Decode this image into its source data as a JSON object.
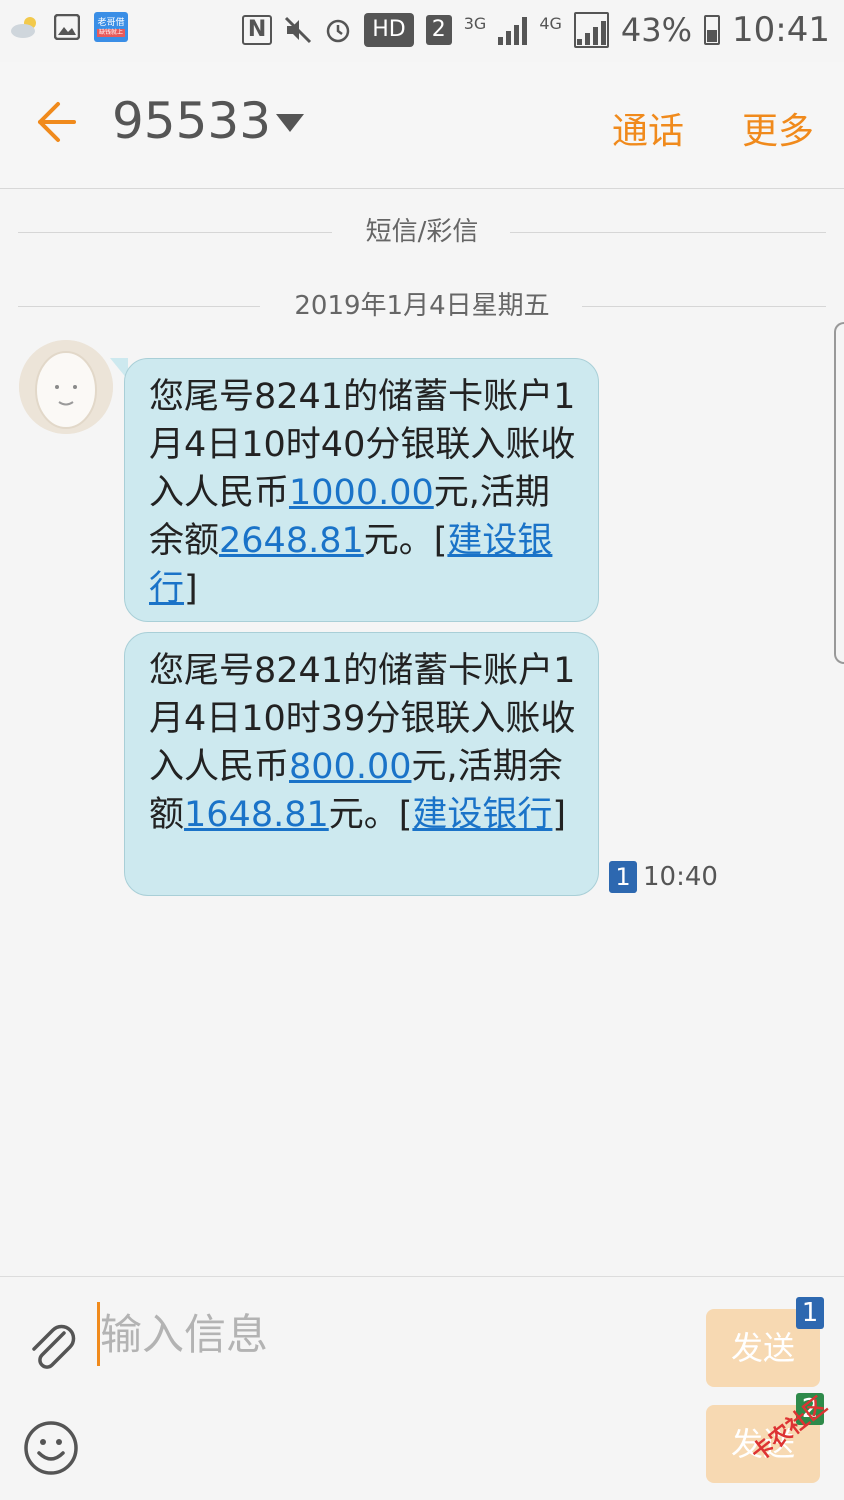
{
  "status_bar": {
    "notif_app_top": "老哥借",
    "notif_app_bottom": "缺钱就上",
    "network_3g": "3G",
    "network_4g": "4G",
    "hd_label": "HD",
    "sim_label": "2",
    "battery_percent": "43%",
    "time": "10:41"
  },
  "header": {
    "title": "95533",
    "call_label": "通话",
    "more_label": "更多"
  },
  "thread": {
    "type_divider": "短信/彩信",
    "date_divider": "2019年1月4日星期五",
    "messages": [
      {
        "part1": "您尾号8241的储蓄卡账户1月4日10时40分银联入账收入人民币",
        "amount": "1000.00",
        "part2": "元,活期余额",
        "balance": "2648.81",
        "part3": "元。[",
        "bank": "建设银行",
        "part4": "]"
      },
      {
        "part1": "您尾号8241的储蓄卡账户1月4日10时39分银联入账收入人民币",
        "amount": "800.00",
        "part2": "元,活期余额",
        "balance": "1648.81",
        "part3": "元。[",
        "bank": "建设银行",
        "part4": "]"
      }
    ],
    "last_sim": "1",
    "last_time": "10:40"
  },
  "composer": {
    "placeholder": "输入信息",
    "send1_label": "发送",
    "send1_sim": "1",
    "send2_label": "发送",
    "send2_sim": "2",
    "watermark": "卡农社区"
  },
  "colors": {
    "accent": "#f08a1c",
    "bubble": "#cde9ef",
    "link": "#1a73c8",
    "sim1": "#2d68b0",
    "sim2": "#2e8a4a"
  }
}
